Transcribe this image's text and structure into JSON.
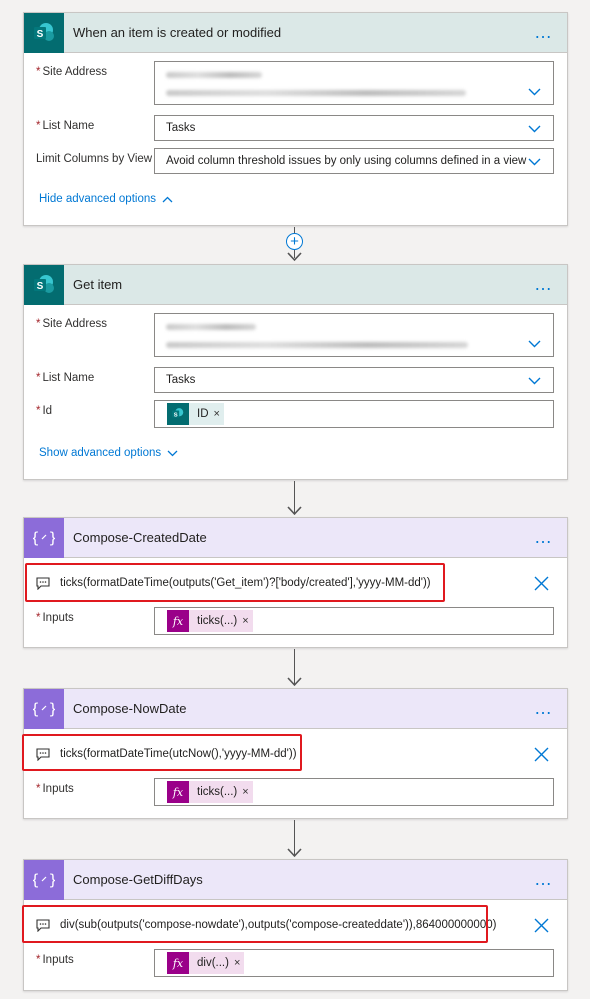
{
  "cards": {
    "trigger": {
      "title": "When an item is created or modified",
      "site_address_label": "Site Address",
      "list_name_label": "List Name",
      "list_name_value": "Tasks",
      "limit_columns_label": "Limit Columns by View",
      "limit_columns_value": "Avoid column threshold issues by only using columns defined in a view",
      "advanced_link": "Hide advanced options"
    },
    "get_item": {
      "title": "Get item",
      "site_address_label": "Site Address",
      "list_name_label": "List Name",
      "list_name_value": "Tasks",
      "id_label": "Id",
      "id_token": "ID",
      "advanced_link": "Show advanced options"
    },
    "compose_created": {
      "title": "Compose-CreatedDate",
      "comment": "ticks(formatDateTime(outputs('Get_item')?['body/created'],'yyyy-MM-dd'))",
      "inputs_label": "Inputs",
      "inputs_token": "ticks(...)"
    },
    "compose_now": {
      "title": "Compose-NowDate",
      "comment": "ticks(formatDateTime(utcNow(),'yyyy-MM-dd'))",
      "inputs_label": "Inputs",
      "inputs_token": "ticks(...)"
    },
    "compose_diff": {
      "title": "Compose-GetDiffDays",
      "comment": "div(sub(outputs('compose-nowdate'),outputs('compose-createddate')),864000000000)",
      "inputs_label": "Inputs",
      "inputs_token": "div(...)"
    }
  },
  "glyphs": {
    "required": "*",
    "more": "…",
    "remove": "×",
    "fx": "fx",
    "plus": "+"
  },
  "colors": {
    "sharepoint": "#036c70",
    "compose": "#8c6cd9",
    "link": "#0078d4",
    "highlight": "#e0191f"
  }
}
